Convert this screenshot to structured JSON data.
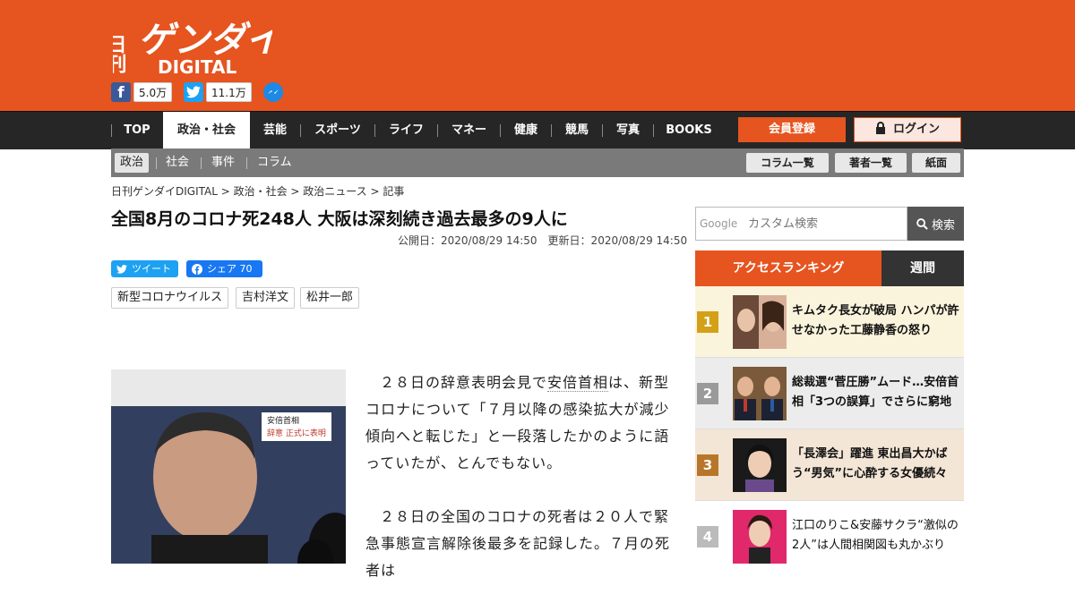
{
  "site": {
    "logo_top": "日刊",
    "logo_main": "ゲンダイ",
    "logo_sub": "DIGITAL",
    "facebook_count": "5.0万",
    "twitter_count": "11.1万",
    "brand_color": "#e6541f"
  },
  "nav": {
    "items": [
      "TOP",
      "政治・社会",
      "芸能",
      "スポーツ",
      "ライフ",
      "マネー",
      "健康",
      "競馬",
      "写真",
      "BOOKS"
    ],
    "active": "政治・社会",
    "register_label": "会員登録",
    "login_label": "ログイン"
  },
  "subnav": {
    "items": [
      "政治",
      "社会",
      "事件",
      "コラム"
    ],
    "active": "政治",
    "buttons": [
      "コラム一覧",
      "著者一覧",
      "紙面"
    ]
  },
  "breadcrumb": "日刊ゲンダイDIGITAL > 政治・社会 > 政治ニュース > 記事",
  "article": {
    "title": "全国8月のコロナ死248人 大阪は深刻続き過去最多の9人に",
    "dates": "公開日：2020/08/29 14:50　更新日：2020/08/29 14:50",
    "tweet_label": "ツイート",
    "share_label": "シェア 70",
    "tags": [
      "新型コロナウイルス",
      "吉村洋文",
      "松井一郎"
    ],
    "photo_caption_1": "安倍首相",
    "photo_caption_2": "辞意 正式に表明",
    "p1_a": "２８日の辞意表明会見で",
    "p1_link": "安倍首相",
    "p1_b": "は、新型コロナについて「７月以降の感染拡大が減少傾向へと転じた」と一段落したかのように語っていたが、とんでもない。",
    "p2": "２８日の全国のコロナの死者は２０人で緊急事態宣言解除後最多を記録した。７月の死者は"
  },
  "sidebar": {
    "search_placeholder": "カスタム検索",
    "search_brand": "Google",
    "search_button": "検索",
    "tab_access": "アクセスランキング",
    "tab_weekly": "週間",
    "ranking": [
      {
        "rank": "1",
        "text": "キムタク長女が破局 ハンパが許せなかった工藤静香の怒り",
        "color": "#d4a017",
        "bg": "#fbf4dc"
      },
      {
        "rank": "2",
        "text": "総裁選“菅圧勝”ムード…安倍首相「3つの誤算」でさらに窮地",
        "color": "#9a9a9a",
        "bg": "#ececec"
      },
      {
        "rank": "3",
        "text": "「長澤会」躍進 東出昌大かばう“男気”に心酔する女優続々",
        "color": "#b8762a",
        "bg": "#f4e6d6"
      },
      {
        "rank": "4",
        "text": "江口のりこ&安藤サクラ“激似の2人”は人間相関図も丸かぶり",
        "color": "#bbbbbb",
        "bg": "#ffffff"
      }
    ]
  }
}
